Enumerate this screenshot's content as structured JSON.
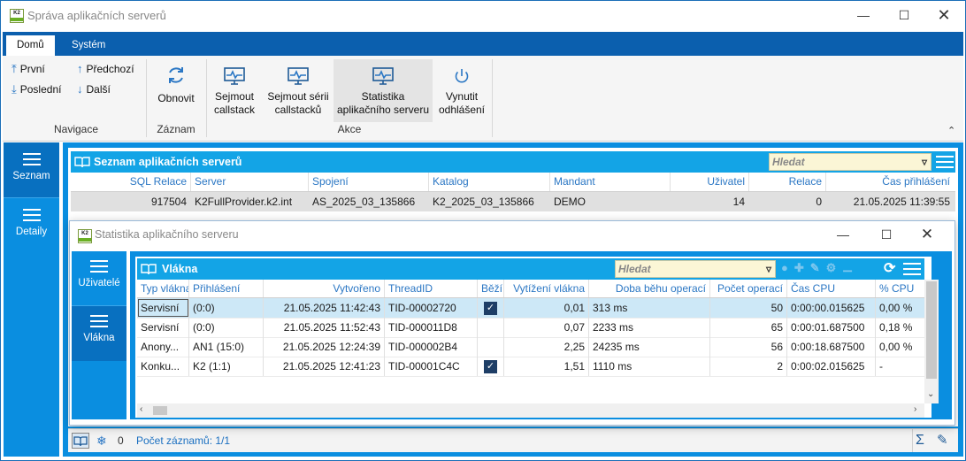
{
  "window": {
    "title": "Správa aplikačních serverů",
    "logo": "K2"
  },
  "ribbon": {
    "tabs": [
      "Domů",
      "Systém"
    ],
    "navigace": {
      "first": "První",
      "prev": "Předchozí",
      "last": "Poslední",
      "next": "Další",
      "group": "Navigace"
    },
    "zaznam": {
      "refresh": "Obnovit",
      "group": "Záznam"
    },
    "akce": {
      "callstack": [
        "Sejmout",
        "callstack"
      ],
      "callstacks": [
        "Sejmout sérii",
        "callstacků"
      ],
      "stats": [
        "Statistika",
        "aplikačního serveru"
      ],
      "logout": [
        "Vynutit",
        "odhlášení"
      ],
      "group": "Akce"
    }
  },
  "leftnav": {
    "items": [
      "Seznam",
      "Detaily"
    ]
  },
  "list": {
    "title": "Seznam aplikačních serverů",
    "search_placeholder": "Hledat",
    "columns": [
      "SQL Relace",
      "Server",
      "Spojení",
      "Katalog",
      "Mandant",
      "Uživatel",
      "Relace",
      "Čas přihlášení"
    ],
    "rows": [
      [
        "917504",
        "K2FullProvider.k2.int",
        "AS_2025_03_135866",
        "K2_2025_03_135866",
        "DEMO",
        "14",
        "0",
        "21.05.2025 11:39:55"
      ]
    ]
  },
  "dialog": {
    "title": "Statistika aplikačního serveru",
    "logo": "K2",
    "nav": [
      "Uživatelé",
      "Vlákna"
    ],
    "panel_title": "Vlákna",
    "search_placeholder": "Hledat",
    "columns": [
      "Typ vlákna",
      "Přihlášení",
      "Vytvořeno",
      "ThreadID",
      "Běží",
      "Vytížení vlákna",
      "Doba běhu operací",
      "Počet operací",
      "Čas CPU",
      "% CPU"
    ],
    "rows": [
      {
        "typ": "Servisní",
        "prihl": "(0:0)",
        "vytvoreno": "21.05.2025 11:42:43",
        "tid": "TID-00002720",
        "bezi": true,
        "vytizeni": "0,01",
        "doba": "313 ms",
        "pocet": "50",
        "cas": "0:00:00.015625",
        "pct": "0,00 %"
      },
      {
        "typ": "Servisní",
        "prihl": "(0:0)",
        "vytvoreno": "21.05.2025 11:52:43",
        "tid": "TID-000011D8",
        "bezi": false,
        "vytizeni": "0,07",
        "doba": "2233 ms",
        "pocet": "65",
        "cas": "0:00:01.687500",
        "pct": "0,18 %"
      },
      {
        "typ": "Anony...",
        "prihl": "AN1 (15:0)",
        "vytvoreno": "21.05.2025 12:24:39",
        "tid": "TID-000002B4",
        "bezi": false,
        "vytizeni": "2,25",
        "doba": "24235 ms",
        "pocet": "56",
        "cas": "0:00:18.687500",
        "pct": "0,00 %"
      },
      {
        "typ": "Konku...",
        "prihl": "K2 (1:1)",
        "vytvoreno": "21.05.2025 12:41:23",
        "tid": "TID-00001C4C",
        "bezi": true,
        "vytizeni": "1,51",
        "doba": "1110 ms",
        "pocet": "2",
        "cas": "0:00:02.015625",
        "pct": "-"
      }
    ]
  },
  "statusbar": {
    "filter_count": "0",
    "records": "Počet záznamů: 1/1"
  },
  "colors": {
    "ribbon_tab_bar": "#0b5fae",
    "left_nav": "#0a8ee0",
    "panel_header": "#13a4e6",
    "selected_row": "#cde8f7",
    "search_bg": "#fbf6d6"
  }
}
